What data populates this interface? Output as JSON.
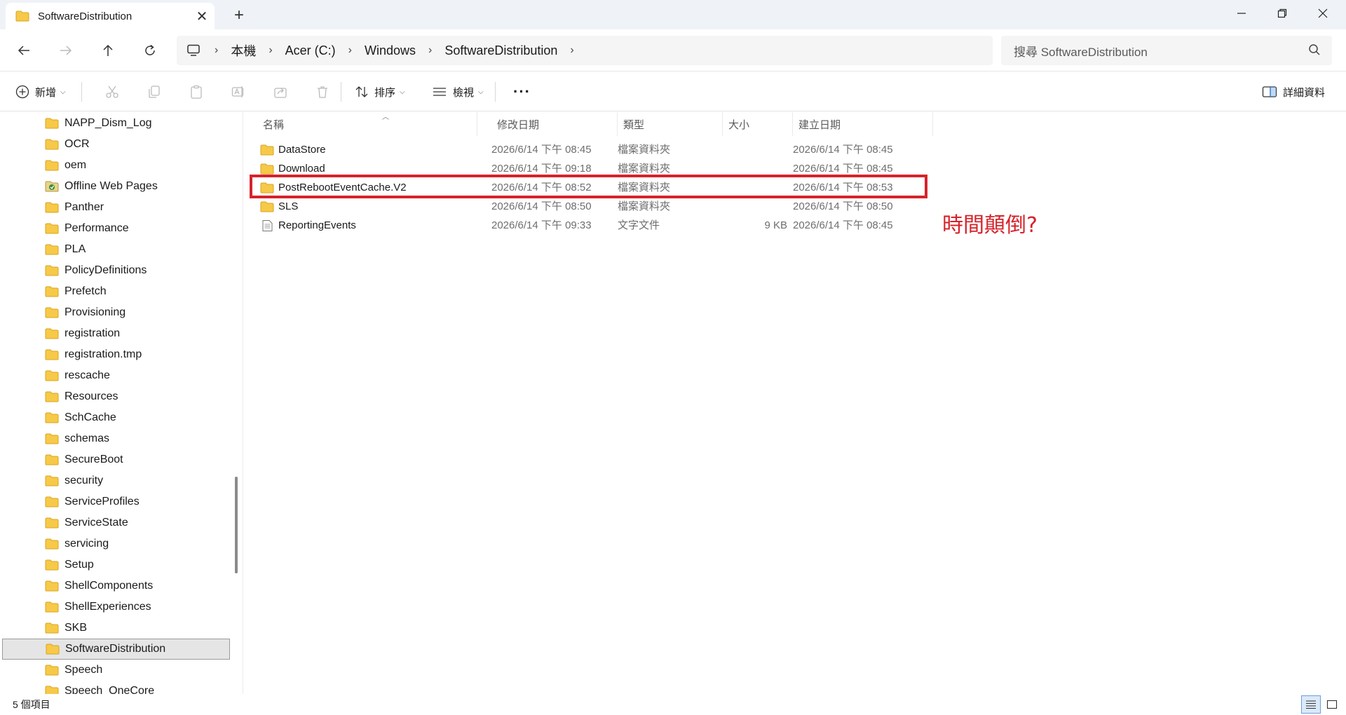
{
  "window": {
    "tab_title": "SoftwareDistribution",
    "close_tab_glyph": "✕",
    "new_tab_glyph": "+"
  },
  "address": {
    "crumbs": [
      "本機",
      "Acer (C:)",
      "Windows",
      "SoftwareDistribution"
    ],
    "search_placeholder": "搜尋 SoftwareDistribution"
  },
  "toolbar": {
    "new_label": "新增",
    "sort_label": "排序",
    "view_label": "檢視",
    "more_label": "···",
    "details_label": "詳細資料"
  },
  "sidebar": {
    "items": [
      {
        "label": "NAPP_Dism_Log",
        "icon": "folder-icon"
      },
      {
        "label": "OCR",
        "icon": "folder-icon"
      },
      {
        "label": "oem",
        "icon": "folder-icon"
      },
      {
        "label": "Offline Web Pages",
        "icon": "offline-pages-icon"
      },
      {
        "label": "Panther",
        "icon": "folder-icon"
      },
      {
        "label": "Performance",
        "icon": "folder-icon"
      },
      {
        "label": "PLA",
        "icon": "folder-icon"
      },
      {
        "label": "PolicyDefinitions",
        "icon": "folder-icon"
      },
      {
        "label": "Prefetch",
        "icon": "folder-icon"
      },
      {
        "label": "Provisioning",
        "icon": "folder-icon"
      },
      {
        "label": "registration",
        "icon": "folder-icon"
      },
      {
        "label": "registration.tmp",
        "icon": "folder-icon"
      },
      {
        "label": "rescache",
        "icon": "folder-icon"
      },
      {
        "label": "Resources",
        "icon": "folder-icon"
      },
      {
        "label": "SchCache",
        "icon": "folder-icon"
      },
      {
        "label": "schemas",
        "icon": "folder-icon"
      },
      {
        "label": "SecureBoot",
        "icon": "folder-icon"
      },
      {
        "label": "security",
        "icon": "folder-icon"
      },
      {
        "label": "ServiceProfiles",
        "icon": "folder-icon"
      },
      {
        "label": "ServiceState",
        "icon": "folder-icon"
      },
      {
        "label": "servicing",
        "icon": "folder-icon"
      },
      {
        "label": "Setup",
        "icon": "folder-icon"
      },
      {
        "label": "ShellComponents",
        "icon": "folder-icon"
      },
      {
        "label": "ShellExperiences",
        "icon": "folder-icon"
      },
      {
        "label": "SKB",
        "icon": "folder-icon"
      },
      {
        "label": "SoftwareDistribution",
        "icon": "folder-icon",
        "selected": true
      },
      {
        "label": "Speech",
        "icon": "folder-icon"
      },
      {
        "label": "Speech_OneCore",
        "icon": "folder-icon"
      }
    ]
  },
  "list": {
    "columns": [
      "名稱",
      "修改日期",
      "類型",
      "大小",
      "建立日期"
    ],
    "rows": [
      {
        "name": "DataStore",
        "modified": "2026/6/14 下午 08:45",
        "type": "檔案資料夾",
        "size": "",
        "created": "2026/6/14 下午 08:45",
        "icon": "folder-icon"
      },
      {
        "name": "Download",
        "modified": "2026/6/14 下午 09:18",
        "type": "檔案資料夾",
        "size": "",
        "created": "2026/6/14 下午 08:45",
        "icon": "folder-icon"
      },
      {
        "name": "PostRebootEventCache.V2",
        "modified": "2026/6/14 下午 08:52",
        "type": "檔案資料夾",
        "size": "",
        "created": "2026/6/14 下午 08:53",
        "icon": "folder-icon"
      },
      {
        "name": "SLS",
        "modified": "2026/6/14 下午 08:50",
        "type": "檔案資料夾",
        "size": "",
        "created": "2026/6/14 下午 08:50",
        "icon": "folder-icon"
      },
      {
        "name": "ReportingEvents",
        "modified": "2026/6/14 下午 09:33",
        "type": "文字文件",
        "size": "9 KB",
        "created": "2026/6/14 下午 08:45",
        "icon": "text-file-icon"
      }
    ]
  },
  "annotation": "時間顛倒?",
  "status": {
    "item_count": "5 個項目"
  },
  "colors": {
    "highlight": "#d6232b",
    "folder": "#f7c948"
  }
}
